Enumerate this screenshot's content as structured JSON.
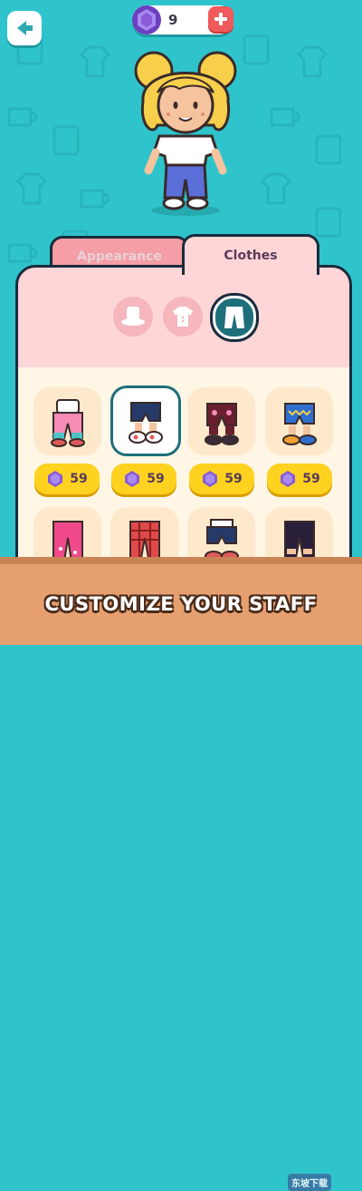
{
  "header": {
    "gem_count": "9"
  },
  "tabs": [
    {
      "label": "Appearance",
      "active": false
    },
    {
      "label": "Clothes",
      "active": true
    }
  ],
  "categories": [
    {
      "icon": "hat-icon",
      "selected": false
    },
    {
      "icon": "shirt-icon",
      "selected": false
    },
    {
      "icon": "pants-icon",
      "selected": true
    }
  ],
  "items": [
    {
      "icon": "pink-overalls-icon",
      "price": "59",
      "selected": false
    },
    {
      "icon": "navy-shorts-icon",
      "price": "59",
      "selected": true
    },
    {
      "icon": "maroon-shorts-icon",
      "price": "59",
      "selected": false
    },
    {
      "icon": "blue-patterned-shorts-icon",
      "price": "59",
      "selected": false
    },
    {
      "icon": "pink-pants-icon",
      "price": "",
      "selected": false
    },
    {
      "icon": "plaid-pants-icon",
      "price": "",
      "selected": false
    },
    {
      "icon": "navy-red-shorts-icon",
      "price": "",
      "selected": false
    },
    {
      "icon": "dark-pants-icon",
      "price": "",
      "selected": false
    }
  ],
  "footer": {
    "caption": "CUSTOMIZE YOUR STAFF"
  },
  "watermark": {
    "text": "东坡下载"
  },
  "colors": {
    "background": "#2fc4cc",
    "accent": "#1f6f7a",
    "panel": "#ffd6d8",
    "price_bg": "#ffd21f",
    "gem": "#8a5ad8"
  }
}
